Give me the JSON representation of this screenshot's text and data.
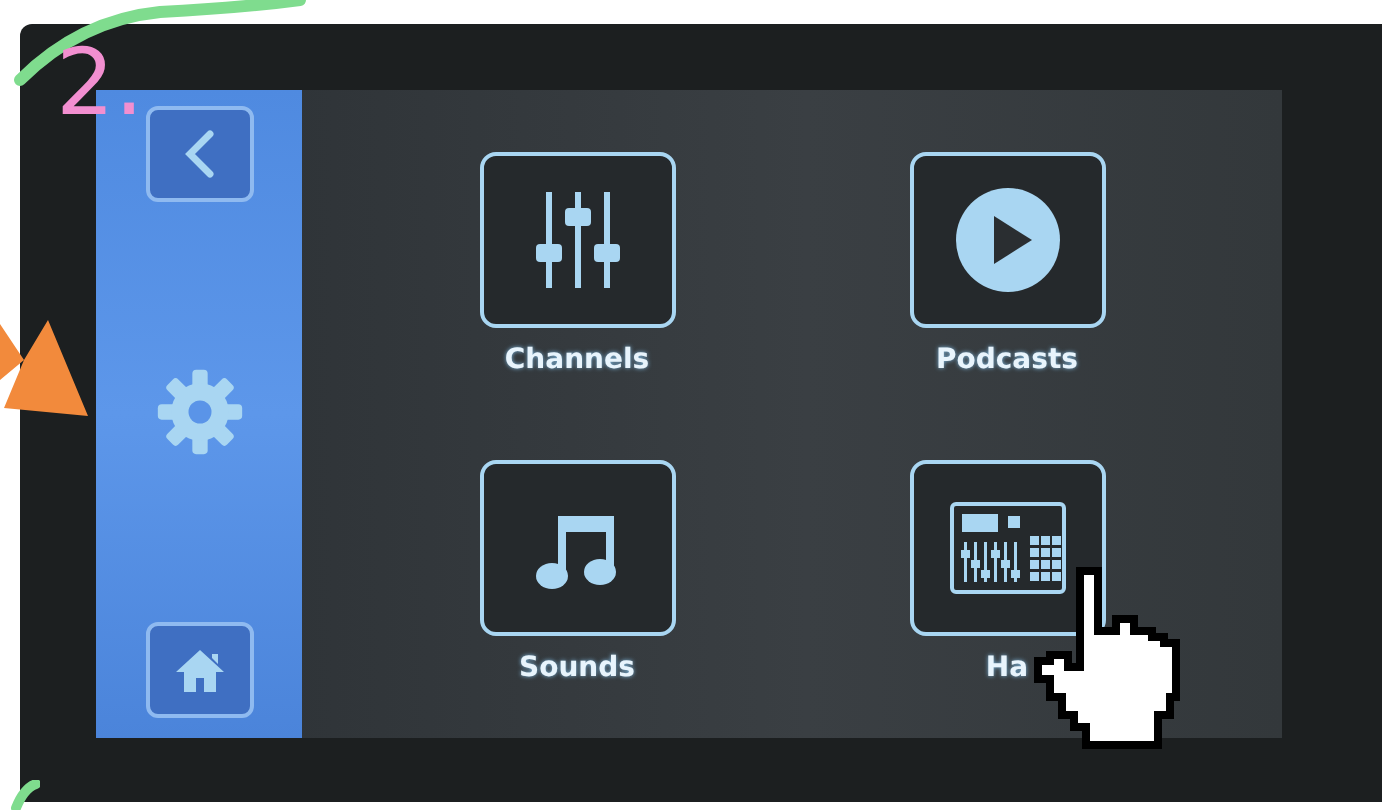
{
  "step_label": "2.",
  "sidebar": {
    "items": [
      {
        "kind": "back"
      },
      {
        "kind": "settings"
      },
      {
        "kind": "home"
      }
    ]
  },
  "tiles": [
    {
      "kind": "channels",
      "label": "Channels"
    },
    {
      "kind": "podcasts",
      "label": "Podcasts"
    },
    {
      "kind": "sounds",
      "label": "Sounds"
    },
    {
      "kind": "hardware",
      "label": "Ha"
    }
  ]
}
